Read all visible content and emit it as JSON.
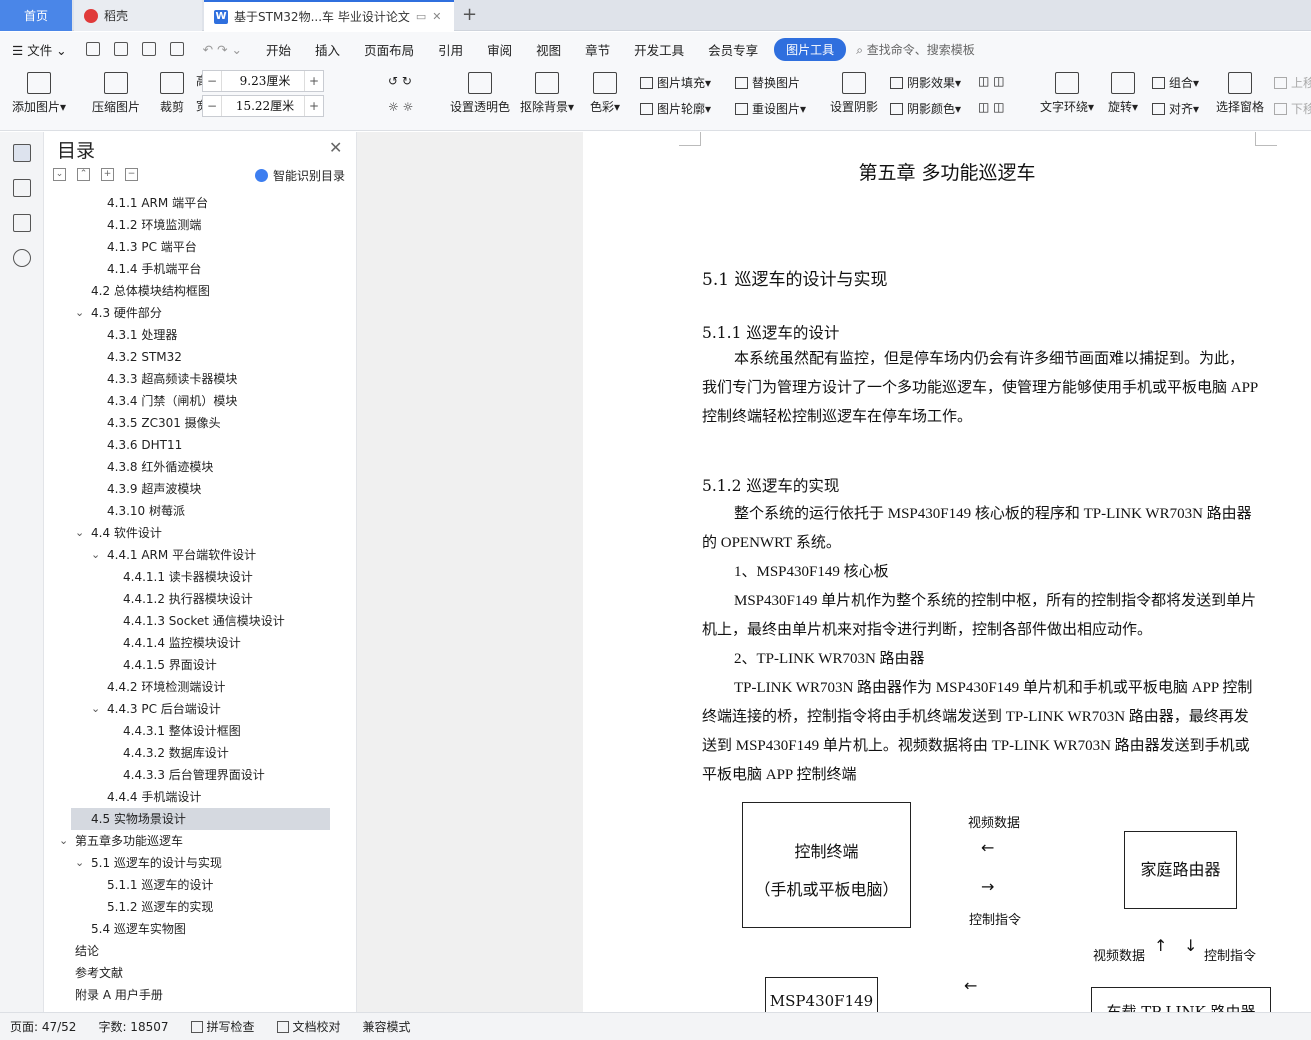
{
  "tabs": {
    "home": "首页",
    "daoke": "稻壳",
    "doc": "基于STM32物...车 毕业设计论文",
    "new_tab": "+"
  },
  "menu": {
    "file": "文件",
    "items": [
      "开始",
      "插入",
      "页面布局",
      "引用",
      "审阅",
      "视图",
      "章节",
      "开发工具",
      "会员专享"
    ],
    "active": "图片工具",
    "search": "查找命令、搜索模板"
  },
  "ribbon": {
    "add_image": "添加图片",
    "compress": "压缩图片",
    "crop": "裁剪",
    "height_label": "高度:",
    "height_value": "9.23厘米",
    "width_label": "宽度:",
    "width_value": "15.22厘米",
    "transparent": "设置透明色",
    "remove_bg": "抠除背景",
    "color": "色彩",
    "fill": "图片填充",
    "outline": "图片轮廓",
    "replace": "替换图片",
    "reset": "重设图片",
    "shadow": "设置阴影",
    "shadow_effect": "阴影效果",
    "shadow_color": "阴影颜色",
    "text_wrap": "文字环绕",
    "rotate": "旋转",
    "group": "组合",
    "align": "对齐",
    "select_pane": "选择窗格",
    "up": "上移",
    "down": "下移"
  },
  "toc": {
    "title": "目录",
    "smart": "智能识别目录",
    "items": [
      {
        "label": "4.1.1 ARM 端平台",
        "level": 2
      },
      {
        "label": "4.1.2  环境监测端",
        "level": 2
      },
      {
        "label": "4.1.3 PC 端平台",
        "level": 2
      },
      {
        "label": "4.1.4  手机端平台",
        "level": 2
      },
      {
        "label": "4.2  总体模块结构框图",
        "level": 1
      },
      {
        "label": "4.3  硬件部分",
        "level": 1,
        "chev": true
      },
      {
        "label": "4.3.1  处理器",
        "level": 2
      },
      {
        "label": "4.3.2 STM32",
        "level": 2
      },
      {
        "label": "4.3.3  超高频读卡器模块",
        "level": 2
      },
      {
        "label": "4.3.4  门禁（闸机）模块",
        "level": 2
      },
      {
        "label": "4.3.5 ZC301 摄像头",
        "level": 2
      },
      {
        "label": "4.3.6 DHT11",
        "level": 2
      },
      {
        "label": "4.3.8  红外循迹模块",
        "level": 2
      },
      {
        "label": "4.3.9  超声波模块",
        "level": 2
      },
      {
        "label": "4.3.10  树莓派",
        "level": 2
      },
      {
        "label": "4.4  软件设计",
        "level": 1,
        "chev": true
      },
      {
        "label": "4.4.1 ARM 平台端软件设计",
        "level": 2,
        "chev": true
      },
      {
        "label": "4.4.1.1  读卡器模块设计",
        "level": 3
      },
      {
        "label": "4.4.1.2  执行器模块设计",
        "level": 3
      },
      {
        "label": "4.4.1.3 Socket 通信模块设计",
        "level": 3
      },
      {
        "label": "4.4.1.4  监控模块设计",
        "level": 3
      },
      {
        "label": "4.4.1.5  界面设计",
        "level": 3
      },
      {
        "label": "4.4.2  环境检测端设计",
        "level": 2
      },
      {
        "label": "4.4.3 PC 后台端设计",
        "level": 2,
        "chev": true
      },
      {
        "label": "4.4.3.1  整体设计框图",
        "level": 3
      },
      {
        "label": "4.4.3.2  数据库设计",
        "level": 3
      },
      {
        "label": "4.4.3.3  后台管理界面设计",
        "level": 3
      },
      {
        "label": "4.4.4  手机端设计",
        "level": 2
      },
      {
        "label": "4.5  实物场景设计",
        "level": 1,
        "highlight": true
      },
      {
        "label": "第五章多功能巡逻车",
        "level": 0,
        "chev": true
      },
      {
        "label": "5.1  巡逻车的设计与实现",
        "level": 1,
        "chev": true
      },
      {
        "label": "5.1.1  巡逻车的设计",
        "level": 2
      },
      {
        "label": "5.1.2  巡逻车的实现",
        "level": 2
      },
      {
        "label": "5.4  巡逻车实物图",
        "level": 1
      },
      {
        "label": "结论",
        "level": 0
      },
      {
        "label": "参考文献",
        "level": 0
      },
      {
        "label": "附录 A  用户手册",
        "level": 0
      }
    ]
  },
  "doc": {
    "chapter": "第五章  多功能巡逻车",
    "h_5_1": "5.1  巡逻车的设计与实现",
    "h_5_1_1": "5.1.1  巡逻车的设计",
    "p1": "本系统虽然配有监控，但是停车场内仍会有许多细节画面难以捕捉到。为此，我们专门为管理方设计了一个多功能巡逻车，使管理方能够使用手机或平板电脑 APP 控制终端轻松控制巡逻车在停车场工作。",
    "h_5_1_2": "5.1.2  巡逻车的实现",
    "p2": "整个系统的运行依托于 MSP430F149 核心板的程序和 TP-LINK WR703N 路由器的 OPENWRT 系统。",
    "p3": "1、MSP430F149 核心板",
    "p4": "MSP430F149 单片机作为整个系统的控制中枢，所有的控制指令都将发送到单片机上，最终由单片机来对指令进行判断，控制各部件做出相应动作。",
    "p5": "2、TP-LINK  WR703N 路由器",
    "p6": "TP-LINK WR703N 路由器作为 MSP430F149 单片机和手机或平板电脑 APP 控制终端连接的桥，控制指令将由手机终端发送到 TP-LINK  WR703N 路由器，最终再发送到 MSP430F149 单片机上。视频数据将由 TP-LINK WR703N 路由器发送到手机或平板电脑 APP 控制终端"
  },
  "diagram": {
    "terminal_line1": "控制终端",
    "terminal_line2": "（手机或平板电脑）",
    "home_router": "家庭路由器",
    "video_data": "视频数据",
    "control_cmd": "控制指令",
    "video_data2": "视频数据",
    "control_cmd2": "控制指令",
    "msp": "MSP430F149",
    "car_router": "车载 TP-LINK 路由器",
    "arrow_left": "←",
    "arrow_right": "→",
    "arrow_up": "↑",
    "arrow_down": "↓"
  },
  "status": {
    "page": "页面: 47/52",
    "words": "字数: 18507",
    "spell": "拼写检查",
    "proof": "文档校对",
    "compat": "兼容模式"
  }
}
